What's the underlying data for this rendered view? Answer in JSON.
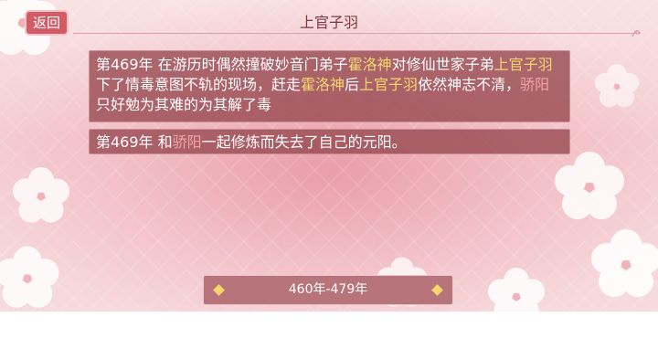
{
  "header": {
    "back_label": "返回",
    "title": "上官子羽"
  },
  "entries": [
    {
      "segments": [
        {
          "text": "第469年 在游历时偶然撞破妙音门弟子",
          "style": "normal"
        },
        {
          "text": "霍洛神",
          "style": "hl"
        },
        {
          "text": "对修仙世家子弟",
          "style": "normal"
        },
        {
          "text": "上官子羽",
          "style": "hl"
        },
        {
          "text": "下了情毒意图不轨的现场，赶走",
          "style": "normal"
        },
        {
          "text": "霍洛神",
          "style": "hl"
        },
        {
          "text": "后",
          "style": "normal"
        },
        {
          "text": "上官子羽",
          "style": "hl"
        },
        {
          "text": "依然神志不清，",
          "style": "normal"
        },
        {
          "text": "骄阳",
          "style": "hl2"
        },
        {
          "text": "只好勉为其难的为其解了毒",
          "style": "normal"
        }
      ]
    },
    {
      "segments": [
        {
          "text": "第469年 和",
          "style": "normal"
        },
        {
          "text": "骄阳",
          "style": "hl2"
        },
        {
          "text": "一起修炼而失去了自己的元阳。",
          "style": "normal"
        }
      ]
    }
  ],
  "footer": {
    "range_label": "460年-479年"
  },
  "colors": {
    "accent": "#d35b66",
    "highlight_gold": "#f5d76e",
    "highlight_pink": "#f3a4a8"
  }
}
